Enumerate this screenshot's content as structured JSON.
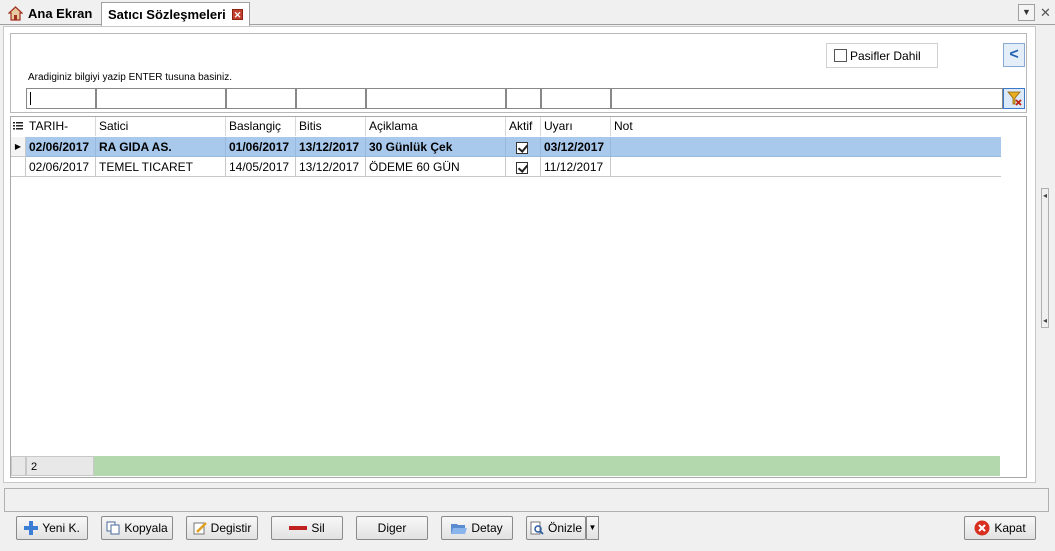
{
  "tabs": {
    "home_label": "Ana Ekran",
    "active_label": "Satıcı Sözleşmeleri",
    "close_glyph": "✕",
    "dropdown_glyph": "▼",
    "window_close_glyph": "✕"
  },
  "filter": {
    "pasif_label": "Pasifler Dahil",
    "collapse_glyph": "<",
    "hint": "Aradiginiz bilgiyi yazip ENTER tusuna basiniz."
  },
  "grid": {
    "columns": [
      "TARIH-",
      "Satici",
      "Baslangiç",
      "Bitis",
      "Açiklama",
      "Aktif",
      "Uyarı",
      "Not"
    ],
    "rows": [
      {
        "tarih": "02/06/2017",
        "satici": "RA GIDA  AS.",
        "baslangic": "01/06/2017",
        "bitis": "13/12/2017",
        "aciklama": "30 Günlük Çek",
        "aktif": true,
        "uyari": "03/12/2017",
        "not": ""
      },
      {
        "tarih": "02/06/2017",
        "satici": "TEMEL TICARET",
        "baslangic": "14/05/2017",
        "bitis": "13/12/2017",
        "aciklama": "ÖDEME 60 GÜN",
        "aktif": true,
        "uyari": "11/12/2017",
        "not": ""
      }
    ],
    "record_count": "2",
    "selected_indicator": "▶"
  },
  "toolbar": {
    "new_label": "Yeni K.",
    "copy_label": "Kopyala",
    "edit_label": "Degistir",
    "delete_label": "Sil",
    "other_label": "Diger",
    "detail_label": "Detay",
    "preview_label": "Önizle",
    "preview_drop_glyph": "▼",
    "close_label": "Kapat"
  },
  "colors": {
    "selection": "#a8c8ec",
    "footer_bar": "#b4d8ae",
    "accent": "#2060b0"
  }
}
